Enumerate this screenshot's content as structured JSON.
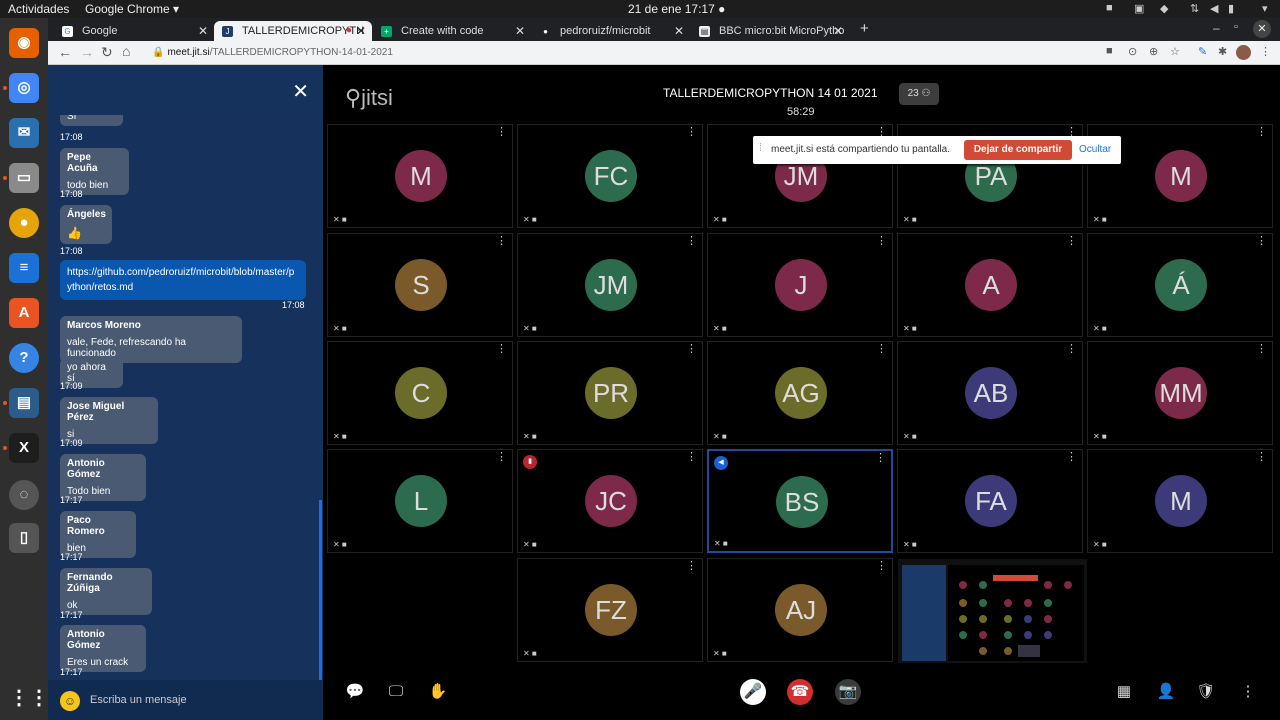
{
  "os_bar": {
    "activities": "Actividades",
    "app": "Google Chrome ▾",
    "clock": "21 de ene  17:17  ●"
  },
  "browser": {
    "tabs": [
      {
        "label": "Google"
      },
      {
        "label": "TALLERDEMICROPYTH"
      },
      {
        "label": "Create with code"
      },
      {
        "label": "pedroruizf/microbit"
      },
      {
        "label": "BBC micro:bit MicroPytho"
      }
    ],
    "url_host": "meet.jit.si",
    "url_path": "/TALLERDEMICROPYTHON-14-01-2021"
  },
  "chat": {
    "placeholder": "Escriba un mensaje",
    "messages": [
      {
        "name": "",
        "text": "Sí",
        "time": "17:08"
      },
      {
        "name": "Pepe Acuña",
        "text": "todo bien",
        "time": "17:08"
      },
      {
        "name": "Ángeles",
        "text": "👍",
        "time": "17:08"
      },
      {
        "own": true,
        "text": "https://github.com/pedroruizf/microbit/blob/master/python/retos.md",
        "time": "17:08"
      },
      {
        "name": "Marcos Moreno",
        "text": "vale, Fede, refrescando ha funcionado",
        "text2": "yo ahora sí",
        "time": "17:09"
      },
      {
        "name": "Jose Miguel Pérez",
        "text": "si",
        "time": "17:09"
      },
      {
        "name": "Antonio Gómez",
        "text": "Todo bien",
        "time": "17:17"
      },
      {
        "name": "Paco Romero",
        "text": "bien",
        "time": "17:17"
      },
      {
        "name": "Fernando Zúñiga",
        "text": "ok",
        "time": "17:17"
      },
      {
        "name": "Antonio Gómez",
        "text": "Eres un crack",
        "time": "17:17"
      }
    ]
  },
  "meeting": {
    "logo": "jitsi",
    "title": "TALLERDEMICROPYTHON 14 01 2021",
    "elapsed": "58:29",
    "participant_count": "23"
  },
  "share_notice": {
    "text": "meet.jit.si está compartiendo tu pantalla.",
    "stop": "Dejar de compartir",
    "hide": "Ocultar"
  },
  "participants": [
    {
      "initials": "M",
      "color": "#7d2a4a"
    },
    {
      "initials": "FC",
      "color": "#2d6b4f"
    },
    {
      "initials": "JM",
      "color": "#7d2a4a"
    },
    {
      "initials": "PA",
      "color": "#2d6b4f"
    },
    {
      "initials": "M",
      "color": "#7d2a4a"
    },
    {
      "initials": "S",
      "color": "#7a5a2a"
    },
    {
      "initials": "JM",
      "color": "#2d6b4f"
    },
    {
      "initials": "J",
      "color": "#7d2a4a"
    },
    {
      "initials": "A",
      "color": "#7d2a4a"
    },
    {
      "initials": "Á",
      "color": "#2d6b4f"
    },
    {
      "initials": "C",
      "color": "#6b6b2a"
    },
    {
      "initials": "PR",
      "color": "#6b6b2a"
    },
    {
      "initials": "AG",
      "color": "#6b6b2a"
    },
    {
      "initials": "AB",
      "color": "#3d3a7a"
    },
    {
      "initials": "MM",
      "color": "#7d2a4a"
    },
    {
      "initials": "L",
      "color": "#2d6b4f"
    },
    {
      "initials": "JC",
      "color": "#7d2a4a"
    },
    {
      "initials": "BS",
      "color": "#2d6b4f"
    },
    {
      "initials": "FA",
      "color": "#3d3a7a"
    },
    {
      "initials": "M",
      "color": "#3d3a7a"
    },
    {
      "initials": "FZ",
      "color": "#7a5a2a"
    },
    {
      "initials": "AJ",
      "color": "#7a5a2a"
    }
  ],
  "toolbar": [
    {
      "name": "chat-toggle-button",
      "glyph": "💬"
    },
    {
      "name": "screen-share-button",
      "glyph": "🖵"
    },
    {
      "name": "raise-hand-button",
      "glyph": "✋"
    },
    {
      "name": "microphone-button",
      "glyph": "🎤"
    },
    {
      "name": "hangup-button",
      "glyph": "☎"
    },
    {
      "name": "camera-button",
      "glyph": "📷"
    },
    {
      "name": "tile-view-button",
      "glyph": "▦"
    },
    {
      "name": "invite-button",
      "glyph": "👤"
    },
    {
      "name": "security-button",
      "glyph": "🛡"
    },
    {
      "name": "more-actions-button",
      "glyph": "⋮"
    }
  ]
}
